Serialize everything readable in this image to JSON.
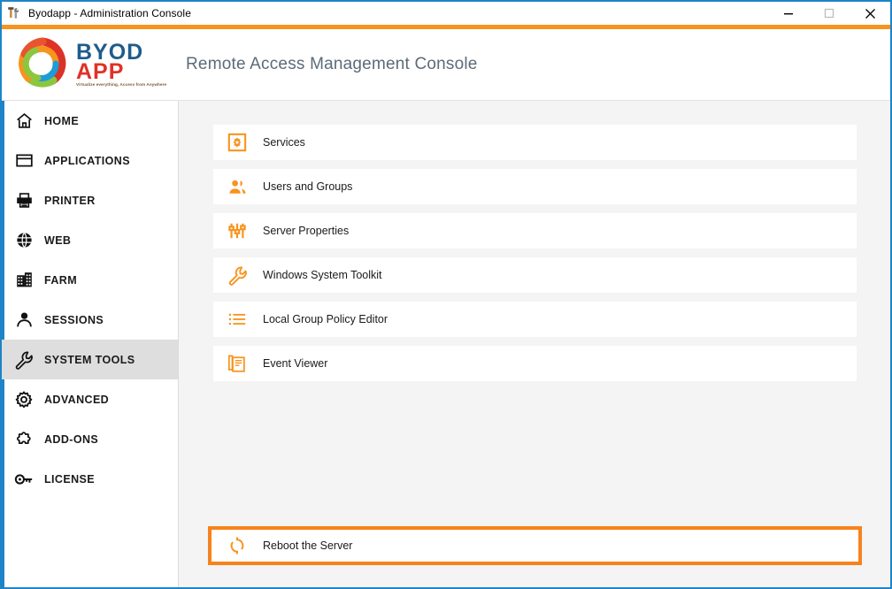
{
  "window": {
    "title": "Byodapp - Administration Console",
    "title_icon": "tools-icon",
    "controls": {
      "minimize": "minimize-icon",
      "maximize": "maximize-icon",
      "close": "close-icon"
    },
    "accent_color": "#f7941e",
    "border_color": "#1e84c8"
  },
  "branding": {
    "logo_primary": "BYOD",
    "logo_secondary": "APP",
    "tagline": "Virtualize everything, Access from Anywhere",
    "logo_primary_color": "#1f5c8b",
    "logo_secondary_color": "#e03127"
  },
  "header": {
    "title": "Remote Access Management Console",
    "title_color": "#5c6b78"
  },
  "sidebar": {
    "selected": "SYSTEM TOOLS",
    "items": [
      {
        "label": "HOME",
        "icon": "home-icon"
      },
      {
        "label": "APPLICATIONS",
        "icon": "window-icon"
      },
      {
        "label": "PRINTER",
        "icon": "printer-icon"
      },
      {
        "label": "WEB",
        "icon": "globe-icon"
      },
      {
        "label": "FARM",
        "icon": "building-icon"
      },
      {
        "label": "SESSIONS",
        "icon": "user-icon"
      },
      {
        "label": "SYSTEM TOOLS",
        "icon": "wrench-icon"
      },
      {
        "label": "ADVANCED",
        "icon": "gear-icon"
      },
      {
        "label": "ADD-ONS",
        "icon": "puzzle-icon"
      },
      {
        "label": "LICENSE",
        "icon": "key-icon"
      }
    ]
  },
  "main": {
    "items": [
      {
        "label": "Services",
        "icon": "gear-box-icon"
      },
      {
        "label": "Users and Groups",
        "icon": "users-icon"
      },
      {
        "label": "Server Properties",
        "icon": "sliders-icon"
      },
      {
        "label": "Windows System Toolkit",
        "icon": "wrench-icon"
      },
      {
        "label": "Local Group Policy Editor",
        "icon": "list-icon"
      },
      {
        "label": "Event Viewer",
        "icon": "document-stack-icon"
      }
    ],
    "reboot": {
      "label": "Reboot the Server",
      "icon": "refresh-icon",
      "highlight_color": "#f7831c"
    }
  }
}
